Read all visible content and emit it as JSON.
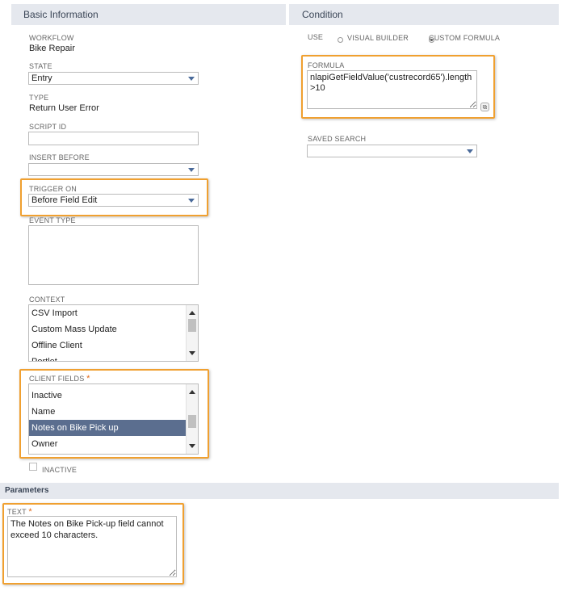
{
  "basic": {
    "title": "Basic Information",
    "workflow_label": "WORKFLOW",
    "workflow_value": "Bike Repair",
    "state_label": "STATE",
    "state_value": "Entry",
    "type_label": "TYPE",
    "type_value": "Return User Error",
    "script_id_label": "SCRIPT ID",
    "script_id_value": "",
    "insert_before_label": "INSERT BEFORE",
    "insert_before_value": "",
    "trigger_on_label": "TRIGGER ON",
    "trigger_on_value": "Before Field Edit",
    "event_type_label": "EVENT TYPE",
    "context_label": "CONTEXT",
    "context_items": [
      "CSV Import",
      "Custom Mass Update",
      "Offline Client",
      "Portlet"
    ],
    "client_fields_label": "CLIENT FIELDS",
    "client_fields_required": "*",
    "client_fields_items": [
      "Inactive",
      "Name",
      "Notes on Bike Pick up",
      "Owner"
    ],
    "client_fields_selected": "Notes on Bike Pick up",
    "inactive_label": "INACTIVE"
  },
  "condition": {
    "title": "Condition",
    "use_label": "USE",
    "visual_builder_label": "VISUAL BUILDER",
    "custom_formula_label": "CUSTOM FORMULA",
    "selected_mode": "custom_formula",
    "formula_label": "FORMULA",
    "formula_value": "nlapiGetFieldValue('custrecord65').length >10",
    "saved_search_label": "SAVED SEARCH",
    "saved_search_value": ""
  },
  "parameters": {
    "title": "Parameters",
    "text_label": "TEXT",
    "text_required": "*",
    "text_value": "The Notes on Bike Pick-up field cannot exceed 10 characters."
  },
  "colors": {
    "highlight": "#f0a030",
    "section_bg": "#e5e8ee",
    "selected_row": "#5b6e8f",
    "required": "#e06a1a"
  }
}
